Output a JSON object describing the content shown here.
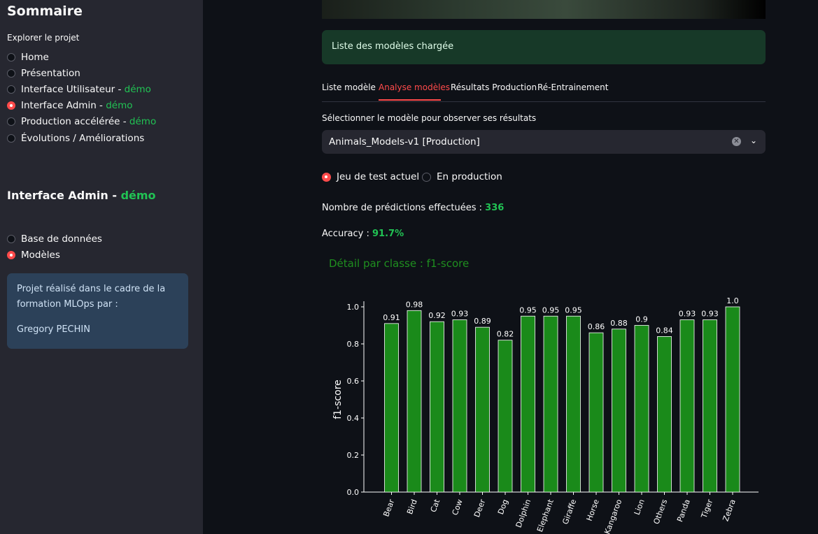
{
  "sidebar": {
    "title": "Sommaire",
    "subtitle": "Explorer le projet",
    "nav": [
      {
        "label": "Home",
        "demo": "",
        "selected": false
      },
      {
        "label": "Présentation",
        "demo": "",
        "selected": false
      },
      {
        "label": "Interface Utilisateur - ",
        "demo": "démo",
        "selected": false
      },
      {
        "label": "Interface Admin - ",
        "demo": "démo",
        "selected": true
      },
      {
        "label": "Production accélérée - ",
        "demo": "démo",
        "selected": false
      },
      {
        "label": "Évolutions / Améliorations",
        "demo": "",
        "selected": false
      }
    ],
    "section_title": "Interface Admin - ",
    "section_demo": "démo",
    "sub_nav": [
      {
        "label": "Base de données",
        "selected": false
      },
      {
        "label": "Modèles",
        "selected": true
      }
    ],
    "info_line1": "Projet réalisé dans le cadre de la formation MLOps par :",
    "info_author": "Gregory PECHIN"
  },
  "main": {
    "success_message": "Liste des modèles chargée",
    "tabs": [
      {
        "label": "Liste modèle",
        "active": false
      },
      {
        "label": "Analyse modèles",
        "active": true
      },
      {
        "label": "Résultats Production",
        "active": false
      },
      {
        "label": "Ré-Entrainement",
        "active": false
      }
    ],
    "select_label": "Sélectionner le modèle pour observer ses résultats",
    "select_value": "Animals_Models-v1 [Production]",
    "radio_options": [
      {
        "label": "Jeu de test actuel",
        "selected": true
      },
      {
        "label": "En production",
        "selected": false
      }
    ],
    "predictions_label": "Nombre de prédictions effectuées : ",
    "predictions_value": "336",
    "accuracy_label": "Accuracy : ",
    "accuracy_value": "91.7%",
    "chart_heading": "Détail par classe : f1-score"
  },
  "colors": {
    "accent": "#ff4b4b",
    "demo_green": "#21c354",
    "bar_fill": "#1a8a1a",
    "sidebar_bg": "#262730",
    "page_bg": "#0e1117"
  },
  "chart_data": {
    "type": "bar",
    "title": "",
    "xlabel": "",
    "ylabel": "f1-score",
    "ylim": [
      0,
      1.0
    ],
    "yticks": [
      "0.0",
      "0.2",
      "0.4",
      "0.6",
      "0.8",
      "1.0"
    ],
    "categories": [
      "Bear",
      "Bird",
      "Cat",
      "Cow",
      "Deer",
      "Dog",
      "Dolphin",
      "Elephant",
      "Giraffe",
      "Horse",
      "Kangaroo",
      "Lion",
      "Others",
      "Panda",
      "Tiger",
      "Zebra"
    ],
    "values": [
      0.91,
      0.98,
      0.92,
      0.93,
      0.89,
      0.82,
      0.95,
      0.95,
      0.95,
      0.86,
      0.88,
      0.9,
      0.84,
      0.93,
      0.93,
      1.0
    ],
    "value_labels": [
      "0.91",
      "0.98",
      "0.92",
      "0.93",
      "0.89",
      "0.82",
      "0.95",
      "0.95",
      "0.95",
      "0.86",
      "0.88",
      "0.9",
      "0.84",
      "0.93",
      "0.93",
      "1.0"
    ],
    "grid": false
  }
}
